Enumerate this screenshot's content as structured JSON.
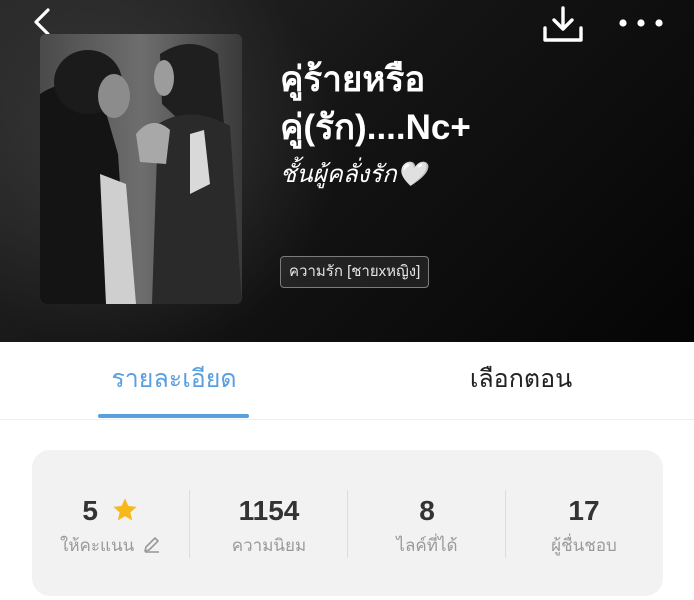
{
  "header": {
    "back_icon": "chevron-left-icon",
    "download_icon": "download-icon",
    "more_icon": "more-horizontal-icon"
  },
  "book": {
    "title_line1": "คู่ร้ายหรือ",
    "title_line2": "คู่(รัก)....Nc+",
    "subtitle": "ชั้นผู้คลั่งรัก🤍",
    "tag": "ความรัก [ชายxหญิง]"
  },
  "tabs": [
    {
      "label": "รายละเอียด",
      "active": true
    },
    {
      "label": "เลือกตอน",
      "active": false
    }
  ],
  "stats": {
    "rating": {
      "value": "5",
      "label": "ให้คะแนน",
      "star_icon": "star-icon",
      "edit_icon": "pencil-icon"
    },
    "popularity": {
      "value": "1154",
      "label": "ความนิยม"
    },
    "likes": {
      "value": "8",
      "label": "ไลค์ที่ได้"
    },
    "fans": {
      "value": "17",
      "label": "ผู้ชื่นชอบ"
    }
  },
  "colors": {
    "accent": "#5a9fe0",
    "star": "#f6b81b",
    "hero_background": "#111111",
    "card_background": "#f2f2f2"
  }
}
